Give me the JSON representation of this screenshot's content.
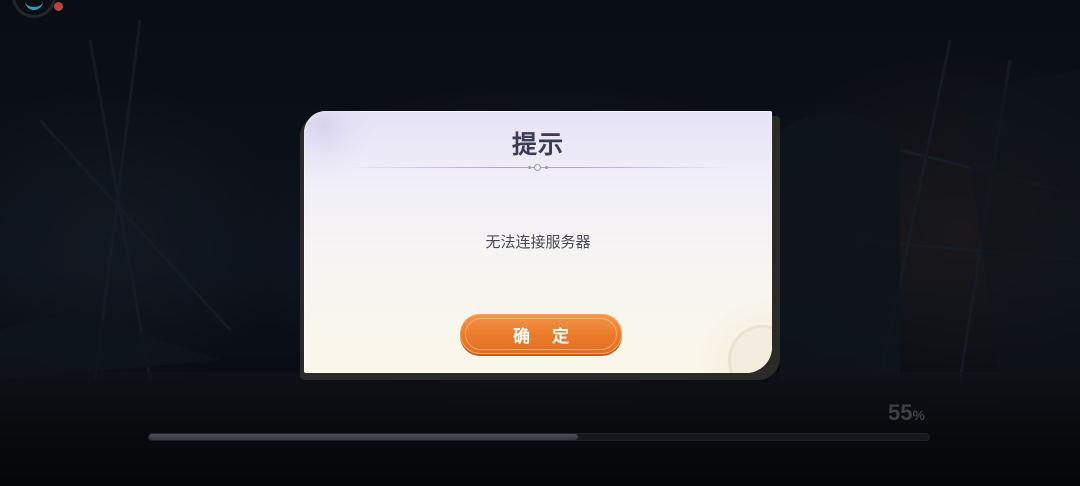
{
  "dialog": {
    "title": "提示",
    "message": "无法连接服务器",
    "confirm_label": "确 定"
  },
  "loading": {
    "percent_value": "55",
    "percent_symbol": "%",
    "progress": 0.55
  },
  "colors": {
    "dialog_title": "#3d3c55",
    "confirm_button": "#ea7a2a",
    "notify_dot": "#e8514a",
    "avatar_accent": "#39c0e0"
  },
  "icons": [
    "avatar-ring-icon",
    "notification-dot-icon"
  ]
}
